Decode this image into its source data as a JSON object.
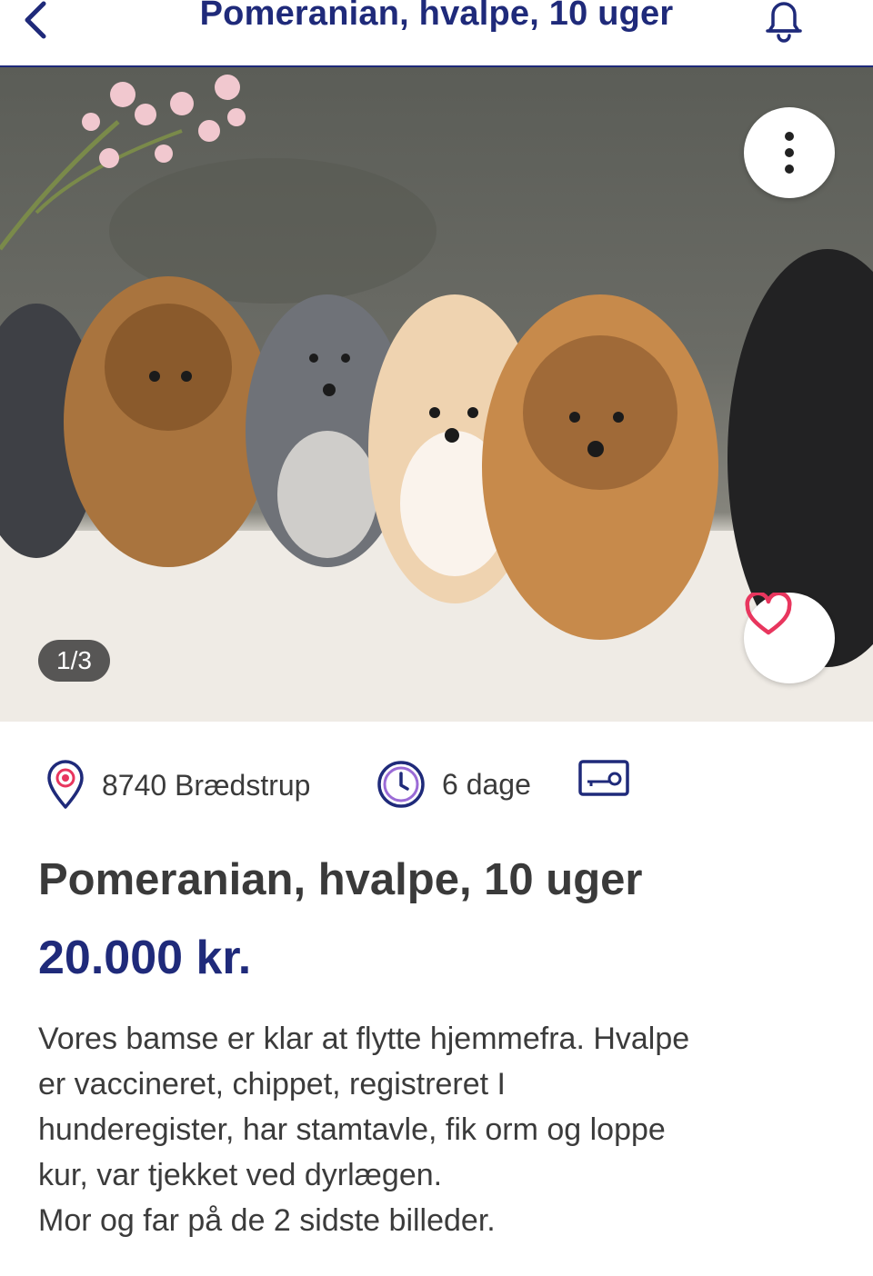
{
  "header": {
    "title": "Pomeranian, hvalpe, 10 uger",
    "back_icon": "chevron-left-icon",
    "bell_icon": "bell-icon"
  },
  "gallery": {
    "counter": "1/3",
    "more_icon": "more-vertical-icon",
    "favorite_icon": "heart-icon"
  },
  "meta": {
    "location": "8740 Brædstrup",
    "age": "6 dage",
    "location_icon": "location-pin-icon",
    "clock_icon": "clock-icon",
    "shipping_icon": "key-card-icon"
  },
  "listing": {
    "title": "Pomeranian, hvalpe, 10 uger",
    "price": "20.000 kr.",
    "description_lines": [
      "Vores bamse er klar at flytte hjemmefra. Hvalpe",
      "er vaccineret, chippet,  registreret I",
      "hunderegister,  har stamtavle,  fik orm og loppe",
      "kur, var tjekket ved dyrlægen.",
      "Mor og far på de 2 sidste billeder."
    ]
  },
  "colors": {
    "brand": "#1f2a7a",
    "accent_pink": "#e8365e",
    "text": "#3a3a3a"
  }
}
